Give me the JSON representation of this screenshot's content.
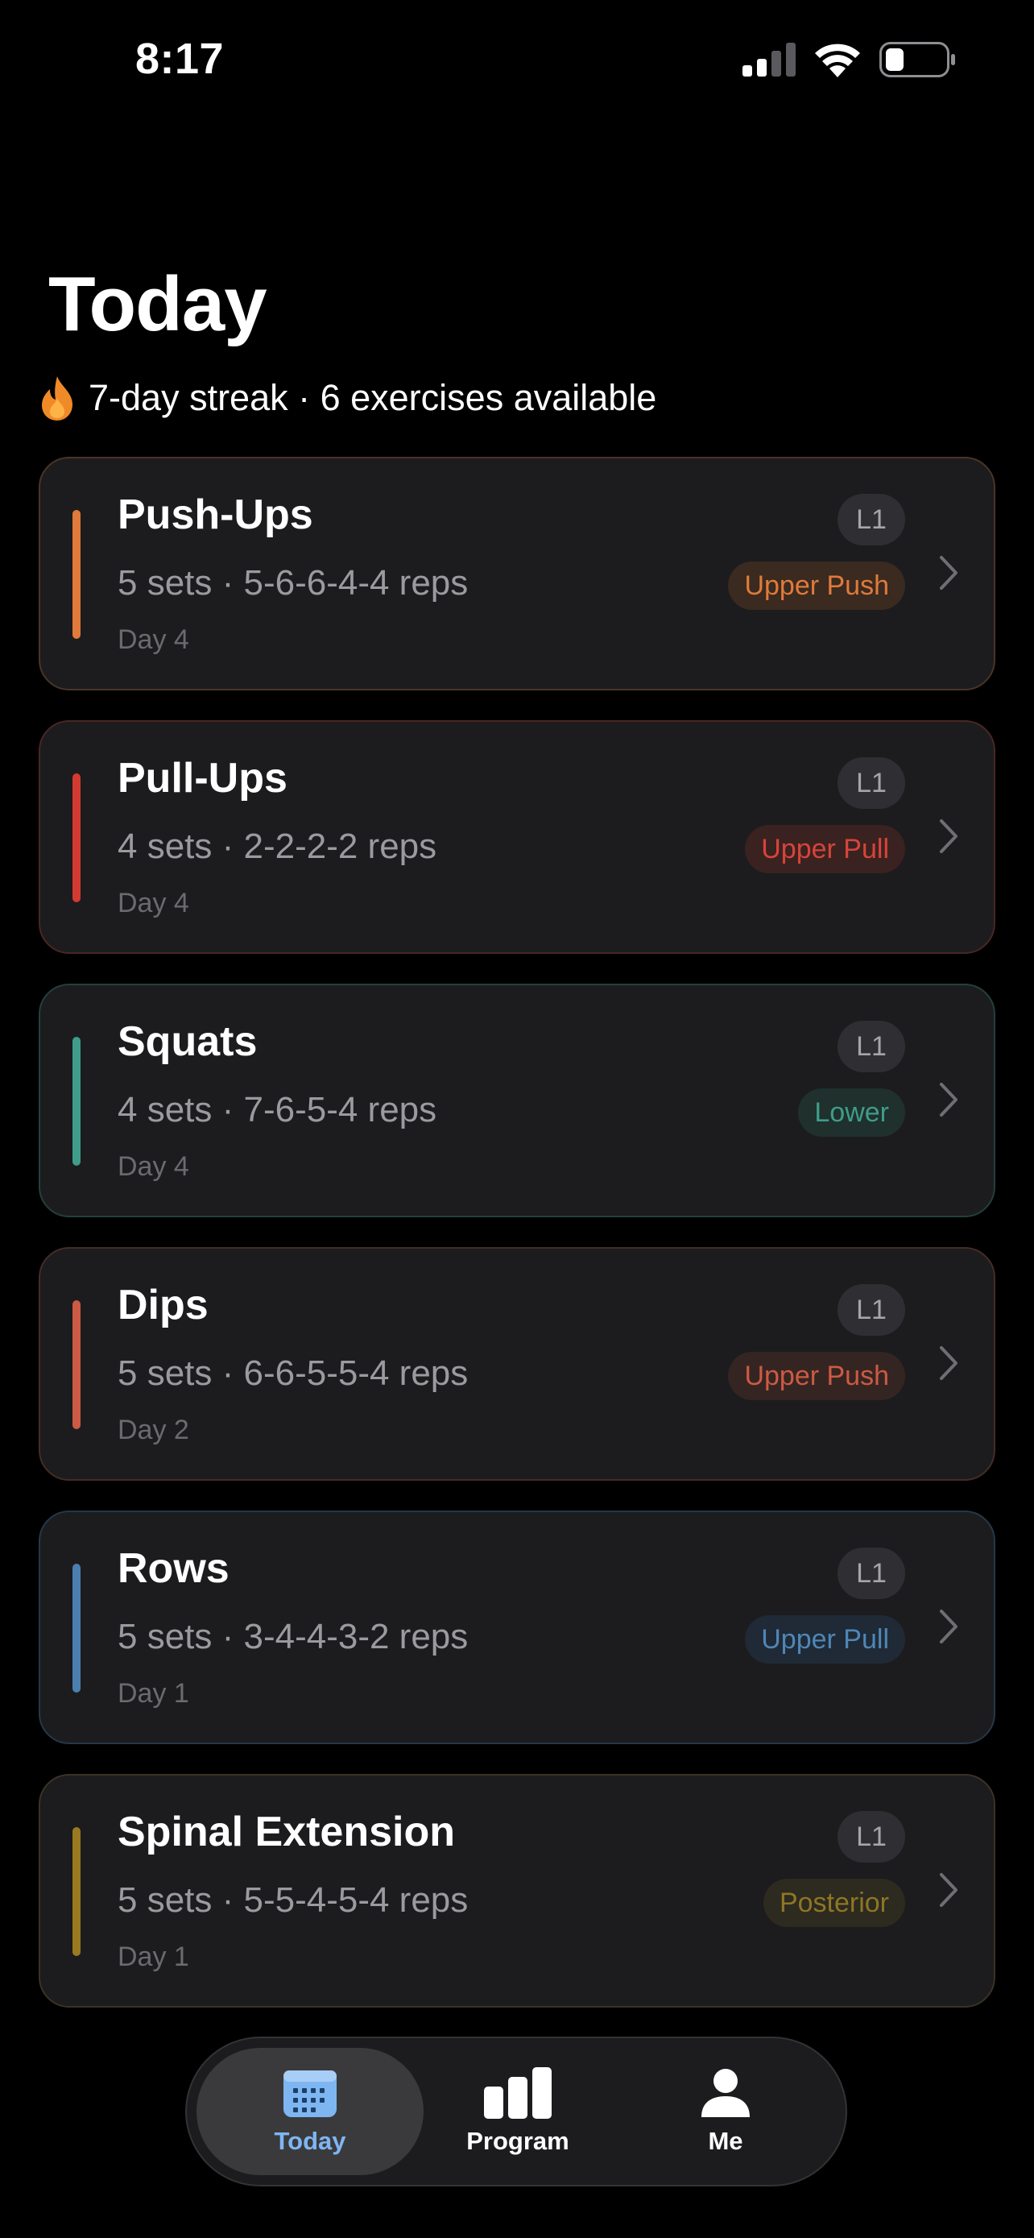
{
  "status_bar": {
    "time": "8:17"
  },
  "header": {
    "title": "Today",
    "streak_icon": "flame-icon",
    "streak_text": "7-day streak · 6 exercises available"
  },
  "colors": {
    "background": "#000000",
    "card": "#1c1c1e",
    "tab_active": "#7eb6f2",
    "tab_inactive": "#ffffff"
  },
  "exercises": [
    {
      "name": "Push-Ups",
      "sets": "5 sets · 5-6-6-4-4 reps",
      "day": "Day 4",
      "level": "L1",
      "category": "Upper Push",
      "accent": "#e07a3a",
      "border": "#4a3426",
      "badge_bg": "#3a2a20",
      "badge_fg": "#e07a3a"
    },
    {
      "name": "Pull-Ups",
      "sets": "4 sets · 2-2-2-2 reps",
      "day": "Day 4",
      "level": "L1",
      "category": "Upper Pull",
      "accent": "#d33a31",
      "border": "#4a2624",
      "badge_bg": "#3a2220",
      "badge_fg": "#d7443a"
    },
    {
      "name": "Squats",
      "sets": "4 sets · 7-6-5-4 reps",
      "day": "Day 4",
      "level": "L1",
      "category": "Lower",
      "accent": "#3f9c8a",
      "border": "#22403c",
      "badge_bg": "#1f302d",
      "badge_fg": "#3f9c8a"
    },
    {
      "name": "Dips",
      "sets": "5 sets · 6-6-5-5-4 reps",
      "day": "Day 2",
      "level": "L1",
      "category": "Upper Push",
      "accent": "#cc5a44",
      "border": "#452c26",
      "badge_bg": "#352522",
      "badge_fg": "#cc5a44"
    },
    {
      "name": "Rows",
      "sets": "5 sets · 3-4-4-3-2 reps",
      "day": "Day 1",
      "level": "L1",
      "category": "Upper Pull",
      "accent": "#4a7fb0",
      "border": "#25384a",
      "badge_bg": "#1f2a36",
      "badge_fg": "#4f86b8"
    },
    {
      "name": "Spinal Extension",
      "sets": "5 sets · 5-5-4-5-4 reps",
      "day": "Day 1",
      "level": "L1",
      "category": "Posterior",
      "accent": "#9a7a20",
      "border": "#3a3324",
      "badge_bg": "#2d2a1f",
      "badge_fg": "#8d7625"
    }
  ],
  "tab_bar": {
    "tabs": [
      {
        "label": "Today",
        "icon": "calendar-icon",
        "active": true
      },
      {
        "label": "Program",
        "icon": "bar-chart-icon",
        "active": false
      },
      {
        "label": "Me",
        "icon": "person-icon",
        "active": false
      }
    ]
  }
}
